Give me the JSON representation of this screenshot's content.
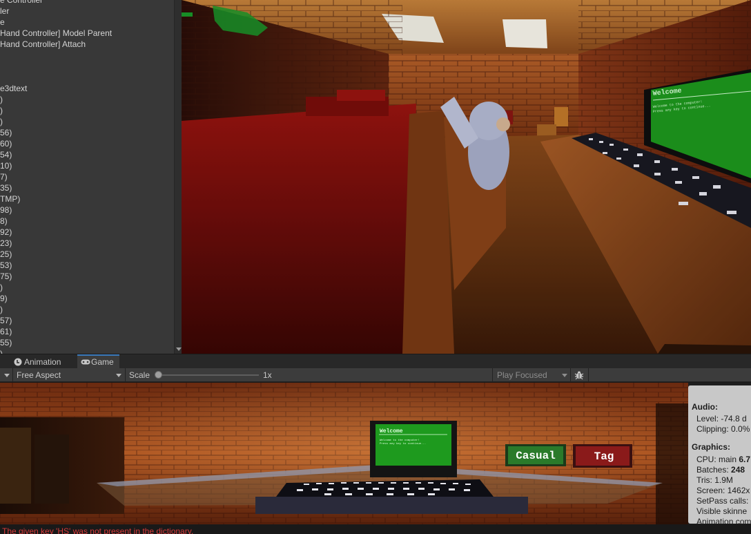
{
  "hierarchy": {
    "rows": [
      "e Controller",
      "ler",
      "e",
      "Hand Controller] Model Parent",
      "Hand Controller] Attach",
      "",
      "",
      "",
      "e3dtext",
      ")",
      ")",
      ")",
      "56)",
      "60)",
      "54)",
      "10)",
      "7)",
      "35)",
      "TMP)",
      "98)",
      "8)",
      "92)",
      "23)",
      "25)",
      "53)",
      "75)",
      ")",
      "9)",
      ")",
      "57)",
      "61)",
      "55)",
      ")"
    ]
  },
  "scene": {
    "monitor_title": "Welcome",
    "monitor_lines": [
      "Welcome to the computer!",
      "Press any key to continue..."
    ]
  },
  "tabs": {
    "animation": "Animation",
    "game": "Game"
  },
  "toolbar": {
    "aspect": "Free Aspect",
    "scale_label": "Scale",
    "scale_value": "1x",
    "scale_fraction": 0.0,
    "play_mode": "Play Focused"
  },
  "game": {
    "monitor_title": "Welcome",
    "monitor_lines": [
      "Welcome to the computer!",
      "Press any key to continue..."
    ],
    "casual_button": "Casual",
    "tag_button": "Tag"
  },
  "stats": {
    "audio_heading": "Audio:",
    "level": "Level: -74.8 d",
    "clipping": "Clipping: 0.0%",
    "graphics_heading": "Graphics:",
    "cpu_label": "CPU: main ",
    "cpu_value": "6.7",
    "batches_label": "Batches: ",
    "batches_value": "248",
    "tris": "Tris: 1.9M",
    "screen": "Screen: 1462x",
    "setpass": "SetPass calls:",
    "visible_skinned": "Visible skinne",
    "animation_comp": "Animation com"
  },
  "console": {
    "error": "The given key 'HS' was not present in the dictionary."
  },
  "colors": {
    "editor_bg": "#383838",
    "game_tab_accent": "#3a79bb",
    "error_text": "#d63a3a",
    "monitor_green": "#1e9a1e",
    "casual_green": "#2a7a2a",
    "tag_red": "#8a1a1a"
  }
}
